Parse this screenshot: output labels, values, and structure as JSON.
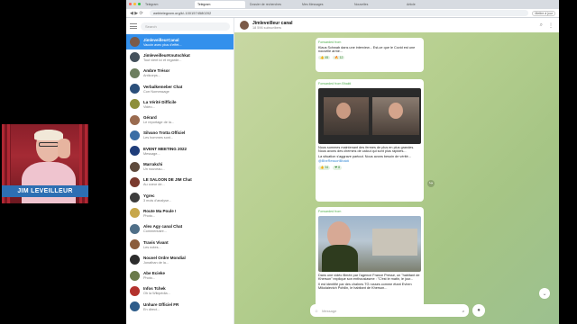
{
  "webcam": {
    "name": "JIM LEVEILLEUR"
  },
  "browser": {
    "tabs": [
      {
        "label": "Telegram"
      },
      {
        "label": "Telegram"
      },
      {
        "label": "Dossier de recherches"
      },
      {
        "label": "Mes Messages"
      },
      {
        "label": "Nouvelles"
      },
      {
        "label": "Article"
      }
    ],
    "url": "webtelegram.org/k/-1001574580202",
    "right_pill": "Mettre à jour"
  },
  "sidebar": {
    "search_placeholder": "Search",
    "chats": [
      {
        "title": "JimleveilleurCanal",
        "preview": "Vaccin avec plus d'effet...",
        "time": "",
        "badge": "",
        "color": "#7b5a48",
        "active": true
      },
      {
        "title": "JimleveilleurKnutschkat",
        "preview": "Tout vient ici et regarde...",
        "time": "",
        "badge": "",
        "color": "#44515c",
        "active": false
      },
      {
        "title": "Ambre Trésor",
        "preview": "Anticorps...",
        "time": "",
        "badge": "",
        "color": "#6c7e5e",
        "active": false
      },
      {
        "title": "Verbalkemeber Chat",
        "preview": "Corr Nomessage",
        "time": "",
        "badge": "",
        "color": "#2b4f7a",
        "active": false
      },
      {
        "title": "La Vérité Difficile",
        "preview": "Vidéo...",
        "time": "",
        "badge": "",
        "color": "#8d8f3a",
        "active": false
      },
      {
        "title": "Gérard",
        "preview": "Le reportage de la...",
        "time": "",
        "badge": "",
        "color": "#9a6b4f",
        "active": false
      },
      {
        "title": "Silvano Trotta Officiel",
        "preview": "Les hommes sont...",
        "time": "",
        "badge": "",
        "color": "#3a6ea5",
        "active": false
      },
      {
        "title": "EVENT MEETING 2022",
        "preview": "Message...",
        "time": "",
        "badge": "",
        "color": "#1f3d7a",
        "active": false
      },
      {
        "title": "Marrakchi",
        "preview": "Un nouveau...",
        "time": "",
        "badge": "",
        "color": "#5e4a3c",
        "active": false
      },
      {
        "title": "LE SALOON DE JIM Chat",
        "preview": "Au coeur de...",
        "time": "",
        "badge": "",
        "color": "#7a3a2e",
        "active": false
      },
      {
        "title": "Ygrec",
        "preview": "3 mois d'analyse...",
        "time": "",
        "badge": "",
        "color": "#3d3d3d",
        "active": false
      },
      {
        "title": "Route Ma Poule !",
        "preview": "Photo...",
        "time": "",
        "badge": "",
        "color": "#c7a74a",
        "active": false
      },
      {
        "title": "Alex Agy canal Chat",
        "preview": "Commentaire...",
        "time": "",
        "badge": "",
        "color": "#4f6f88",
        "active": false
      },
      {
        "title": "Travis Vivant",
        "preview": "Les notes...",
        "time": "",
        "badge": "",
        "color": "#8b5d3b",
        "active": false
      },
      {
        "title": "Nouvel Ordre Mondial",
        "preview": "Jonathan de la...",
        "time": "",
        "badge": "",
        "color": "#2c2c2c",
        "active": false
      },
      {
        "title": "Abe Ecieke",
        "preview": "Photo...",
        "time": "",
        "badge": "",
        "color": "#6b7b4b",
        "active": false
      },
      {
        "title": "Infos Tchek",
        "preview": "Oh la Wikipédia...",
        "time": "",
        "badge": "",
        "color": "#b3322d",
        "active": false
      },
      {
        "title": "Unhare Officiel FR",
        "preview": "En direct...",
        "time": "",
        "badge": "",
        "color": "#2e5c8a",
        "active": false
      }
    ]
  },
  "chat": {
    "title": "Jimleveilleur canal",
    "subtitle": "18 596 subscribers",
    "messages": [
      {
        "forward": "Forwarded from",
        "text": "Klaus Schwab dans une interview... Est-ce que le Covid est une nouvelle arme...",
        "reactions": [
          "👍 45",
          "🔥 12"
        ]
      },
      {
        "forward": "Forwarded from Bhakti",
        "text": "Nous sommes maintenant des fermes de plus en plus grandes. Nous avons des chemins de calcul qui sont plus rapides...",
        "text2": "La situation s'aggrave partout. Nous avons besoin de vérité...",
        "link": "@BheRessortBhakti",
        "reactions": [
          "👍 34",
          "❤ 8"
        ]
      },
      {
        "forward": "Forwarded from",
        "text": "Dans une vidéo filmée par l'agence France Presse, un \"habitant de Kherson\" explique son enthousiasme : \"C'est le matin, le jour...",
        "text2": "Il est identifié par des chaînes TG russes comme étant Evhen Mikolaievich Pohilin, le habitant de Kherson..."
      }
    ],
    "composer_placeholder": "Message"
  }
}
